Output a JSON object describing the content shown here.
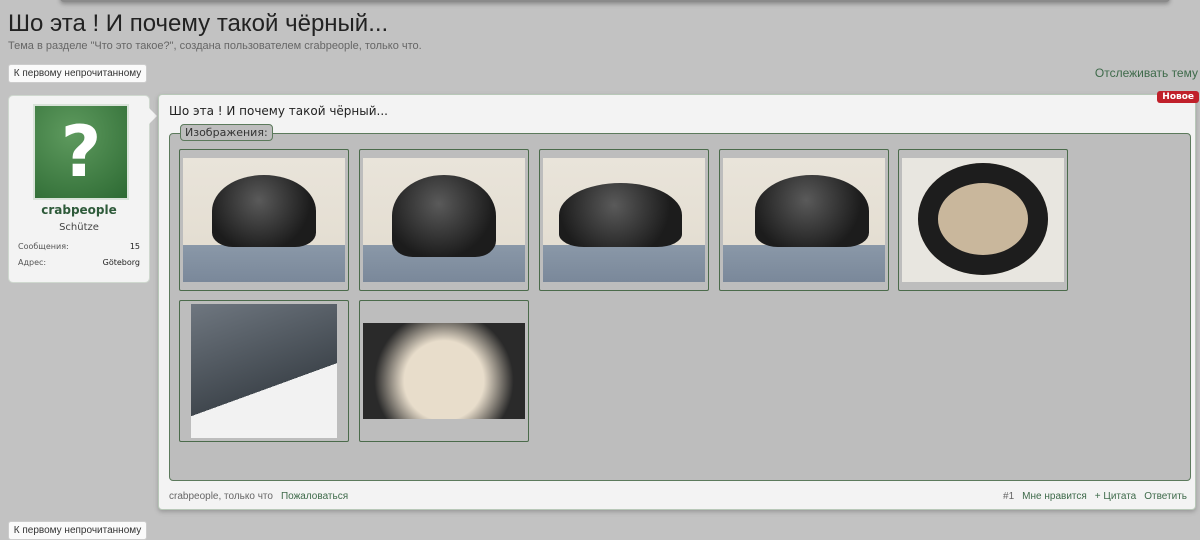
{
  "thread": {
    "title": "Шо эта ! И почему такой чёрный...",
    "subtitle": "Тема в разделе \"Что это такое?\", создана пользователем crabpeople, только что.",
    "first_unread": "К первому непрочитанному",
    "watch": "Отслеживать тему"
  },
  "user": {
    "name": "crabpeople",
    "rank": "Schütze",
    "messages_label": "Сообщения:",
    "messages": "15",
    "address_label": "Адрес:",
    "address": "Göteborg"
  },
  "post": {
    "title": "Шо эта ! И почему такой чёрный...",
    "badge": "Новое",
    "attachments_label": "Изображения:",
    "author": "crabpeople, только что",
    "report": "Пожаловаться",
    "number": "#1",
    "like": "Мне нравится",
    "quote": "+ Цитата",
    "reply": "Ответить"
  },
  "colors": {
    "accent": "#3e6a4a",
    "badge": "#c0202a"
  }
}
